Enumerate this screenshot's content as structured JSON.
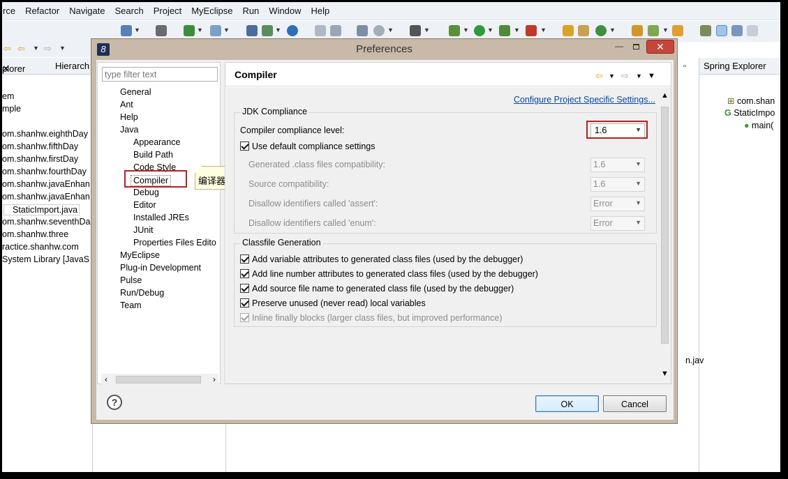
{
  "menubar": [
    "rce",
    "Refactor",
    "Navigate",
    "Search",
    "Project",
    "MyEclipse",
    "Run",
    "Window",
    "Help"
  ],
  "left_panel": {
    "tabs": [
      "plorer",
      "Hierarch"
    ],
    "tree": [
      "em",
      "mple",
      "om.shanhw.eighthDay",
      "om.shanhw.fifthDay",
      "om.shanhw.firstDay",
      "om.shanhw.fourthDay",
      "om.shanhw.javaEnhan",
      "om.shanhw.javaEnhan",
      "StaticImport.java",
      "om.shanhw.seventhDa",
      "om.shanhw.three",
      "ractice.shanhw.com",
      "System Library [JavaS"
    ]
  },
  "right_panel": {
    "tab": "Spring Explorer",
    "items": [
      "com.shan",
      "StaticImpo",
      "main("
    ],
    "lower_text": "n.jav"
  },
  "dialog": {
    "title": "Preferences",
    "filter_placeholder": "type filter text",
    "tree": {
      "top": [
        "General",
        "Ant",
        "Help",
        "Java"
      ],
      "java_children": [
        "Appearance",
        "Build Path",
        "Code Style",
        "Compiler",
        "Debug",
        "Editor",
        "Installed JREs",
        "JUnit",
        "Properties Files Edito"
      ],
      "bottom": [
        "MyEclipse",
        "Plug-in Development",
        "Pulse",
        "Run/Debug",
        "Team"
      ]
    },
    "annotation": "编译器",
    "page": {
      "title": "Compiler",
      "link": "Configure Project Specific Settings...",
      "jdk_group": {
        "label": "JDK Compliance",
        "compliance_label": "Compiler compliance level:",
        "compliance_value": "1.6",
        "use_default": "Use default compliance settings",
        "rows": [
          {
            "label": "Generated .class files compatibility:",
            "value": "1.6"
          },
          {
            "label": "Source compatibility:",
            "value": "1.6"
          },
          {
            "label": "Disallow identifiers called 'assert':",
            "value": "Error"
          },
          {
            "label": "Disallow identifiers called 'enum':",
            "value": "Error"
          }
        ]
      },
      "classfile_group": {
        "label": "Classfile Generation",
        "options": [
          "Add variable attributes to generated class files (used by the debugger)",
          "Add line number attributes to generated class files (used by the debugger)",
          "Add source file name to generated class file (used by the debugger)",
          "Preserve unused (never read) local variables",
          "Inline finally blocks (larger class files, but improved performance)"
        ]
      }
    },
    "buttons": {
      "ok": "OK",
      "cancel": "Cancel",
      "help": "?"
    }
  }
}
